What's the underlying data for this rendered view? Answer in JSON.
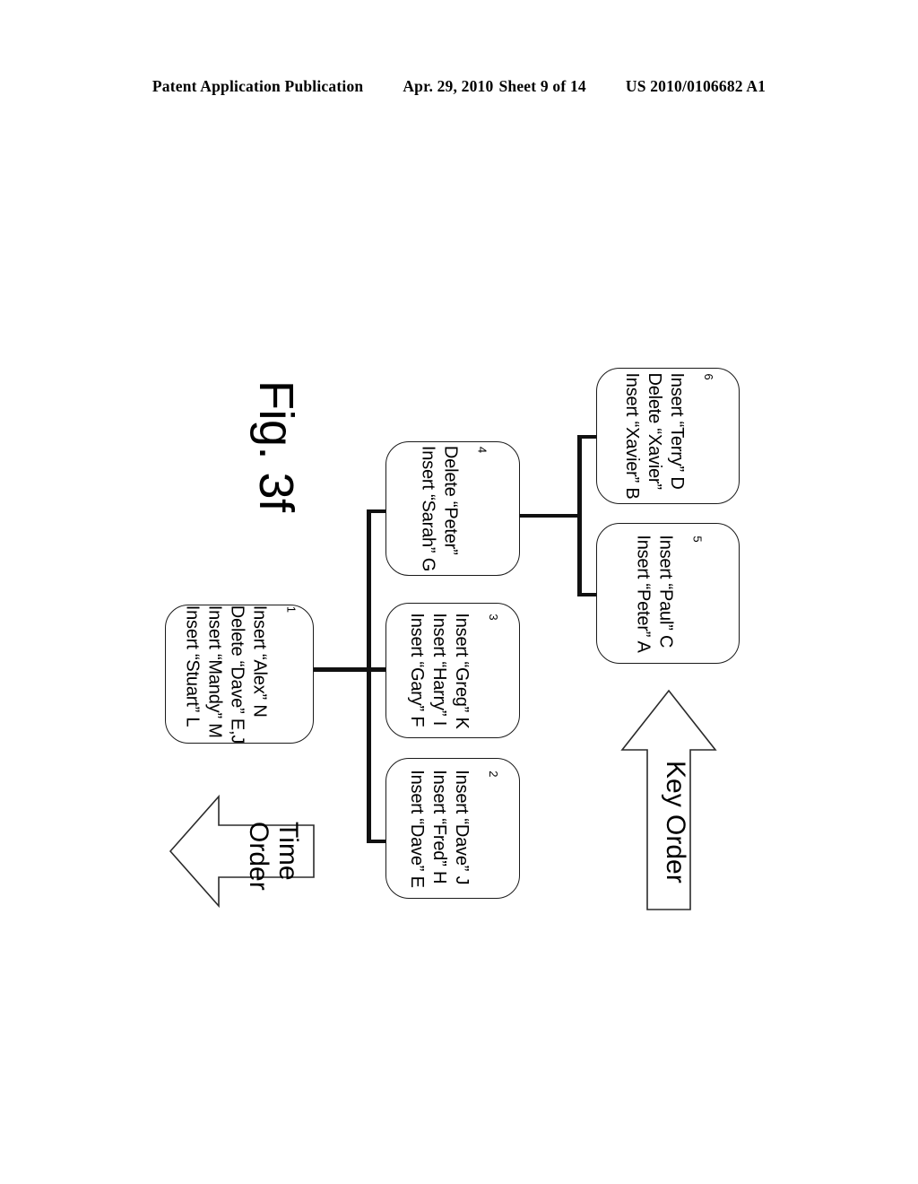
{
  "header": {
    "publication": "Patent Application Publication",
    "date": "Apr. 29, 2010",
    "sheet": "Sheet 9 of 14",
    "number": "US 2010/0106682 A1"
  },
  "figure": {
    "title": "Fig. 3f",
    "nodes": [
      {
        "id": "1",
        "lines": [
          "Insert “Alex” N",
          "Delete “Dave” E,J",
          "Insert “Mandy” M",
          "Insert “Stuart” L"
        ]
      },
      {
        "id": "2",
        "lines": [
          "Insert “Dave” J",
          "Insert “Fred” H",
          "Insert “Dave” E"
        ]
      },
      {
        "id": "3",
        "lines": [
          "Insert “Greg” K",
          "Insert “Harry” I",
          "Insert “Gary” F"
        ]
      },
      {
        "id": "4",
        "lines": [
          "Delete “Peter”",
          "Insert “Sarah” G"
        ]
      },
      {
        "id": "5",
        "lines": [
          "Insert “Paul” C",
          "Insert “Peter” A"
        ]
      },
      {
        "id": "6",
        "lines": [
          "Insert “Terry” D",
          "Delete “Xavier”",
          "Insert “Xavier” B"
        ]
      }
    ],
    "arrows": [
      {
        "name": "time-order",
        "label_line1": "Time",
        "label_line2": "Order",
        "direction": "left"
      },
      {
        "name": "key-order",
        "label_line1": "Key Order",
        "label_line2": "",
        "direction": "up"
      }
    ]
  },
  "colors": {
    "ink": "#000000",
    "line": "#111111",
    "background": "#ffffff"
  }
}
